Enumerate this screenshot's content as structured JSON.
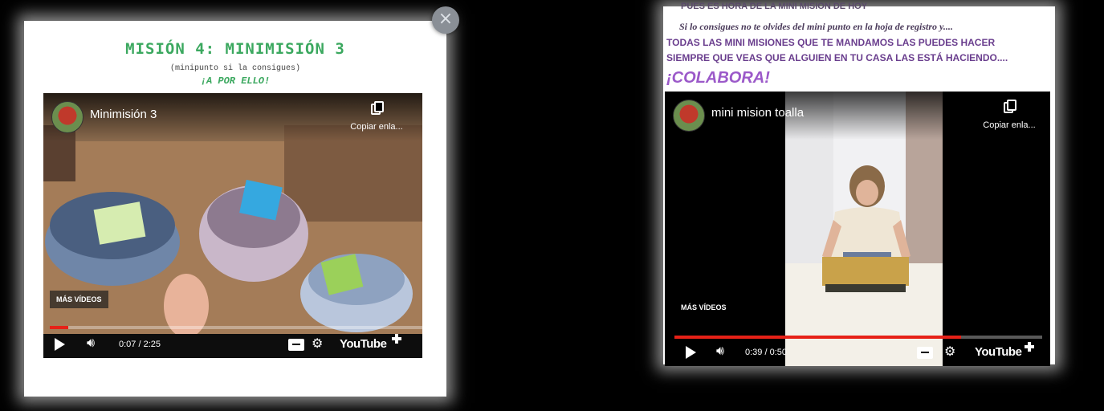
{
  "left_card": {
    "title": "MISIÓN 4: MINIMISIÓN 3",
    "subtitle": "(minipunto si la consigues)",
    "call_to_action": "¡A POR ELLO!",
    "video": {
      "title": "Minimisión 3",
      "copy_link_label": "Copiar enla...",
      "more_videos": "MÁS VÍDEOS",
      "time": "0:07 / 2:25",
      "progress": 0.05,
      "brand": "YouTube"
    }
  },
  "right_card": {
    "cut_text": "PUES ES HORA DE LA MINI MISION DE HOY",
    "register_line": "Si lo consigues no te olvides del mini punto en la hoja de registro y....",
    "caps_line_1": "TODAS LAS MINI MISIONES QUE TE MANDAMOS LAS PUEDES HACER",
    "caps_line_2": "SIEMPRE QUE VEAS QUE ALGUIEN EN TU CASA LAS ESTÁ HACIENDO....",
    "colabora": "¡COLABORA!",
    "video": {
      "title": "mini mision toalla",
      "copy_link_label": "Copiar enla...",
      "more_videos": "MÁS VÍDEOS",
      "time": "0:39 / 0:50",
      "progress": 0.78,
      "brand": "YouTube"
    }
  },
  "close_symbol": "×",
  "colors": {
    "mission_green": "#3ba85f",
    "purple_text": "#6a3e8e",
    "colabora_purple": "#9b59c9",
    "progress_red": "#e62117"
  }
}
